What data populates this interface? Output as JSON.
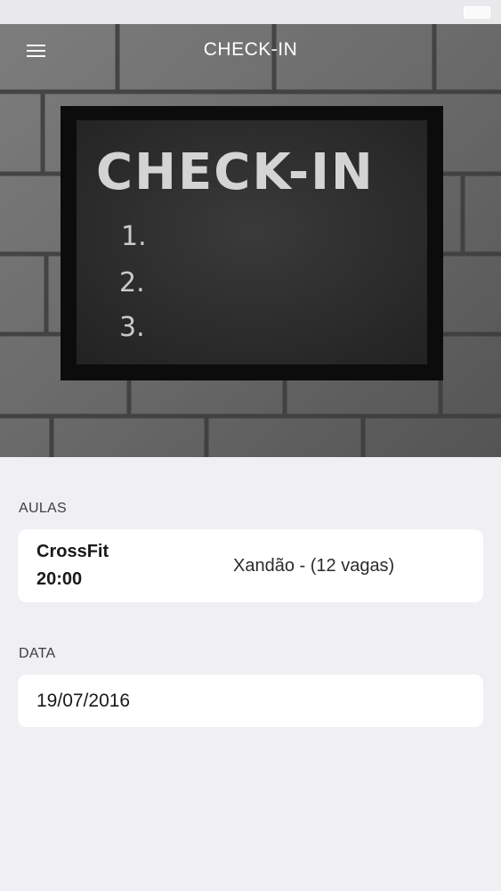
{
  "header": {
    "title": "CHECK-IN"
  },
  "hero": {
    "board_title": "CHECK-IN",
    "list_numbers": [
      "1.",
      "2.",
      "3."
    ]
  },
  "classes": {
    "label": "AULAS",
    "selected": {
      "name": "CrossFit",
      "time": "20:00",
      "coach": "Xandão - (12 vagas)"
    }
  },
  "date": {
    "label": "DATA",
    "value": "19/07/2016"
  },
  "colors": {
    "background": "#efeff4",
    "card": "#ffffff",
    "chalkboard": "#2f2f2f",
    "chalk": "#e6e6e6"
  }
}
